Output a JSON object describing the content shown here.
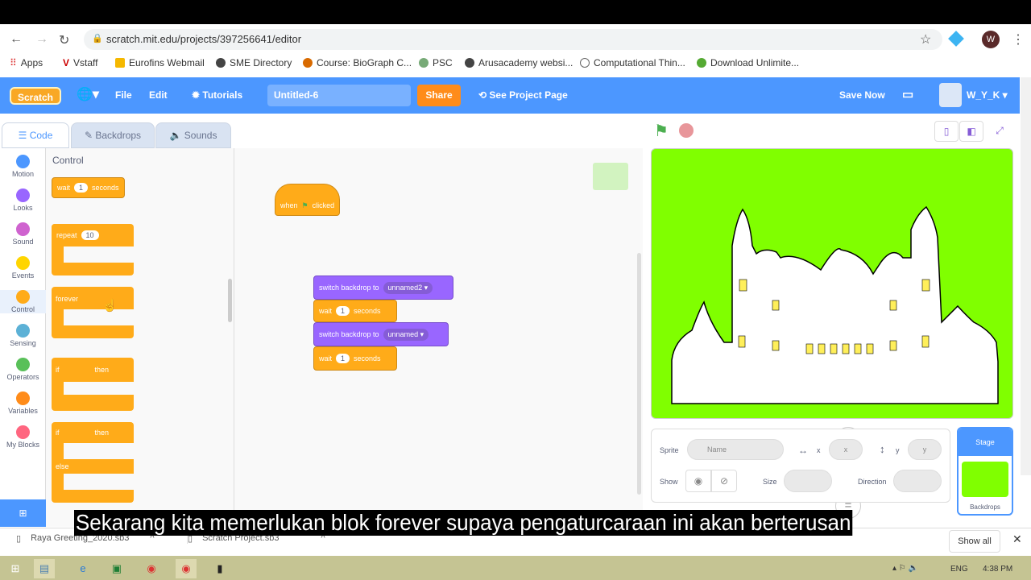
{
  "browser": {
    "url": "scratch.mit.edu/projects/397256641/editor",
    "profile_initial": "W",
    "bookmarks": [
      "Apps",
      "Vstaff",
      "Eurofins Webmail",
      "SME Directory",
      "Course: BioGraph C...",
      "PSC",
      "Arusacademy websi...",
      "Computational Thin...",
      "Download Unlimite..."
    ]
  },
  "menubar": {
    "logo": "Scratch",
    "file": "File",
    "edit": "Edit",
    "tutorials": "Tutorials",
    "project_title": "Untitled-6",
    "share": "Share",
    "see_project": "See Project Page",
    "save_now": "Save Now",
    "username": "W_Y_K"
  },
  "tabs": [
    "Code",
    "Backdrops",
    "Sounds"
  ],
  "categories": [
    {
      "label": "Motion",
      "color": "#4c97ff"
    },
    {
      "label": "Looks",
      "color": "#9966ff"
    },
    {
      "label": "Sound",
      "color": "#cf63cf"
    },
    {
      "label": "Events",
      "color": "#ffd500"
    },
    {
      "label": "Control",
      "color": "#ffab19"
    },
    {
      "label": "Sensing",
      "color": "#5cb1d6"
    },
    {
      "label": "Operators",
      "color": "#59c059"
    },
    {
      "label": "Variables",
      "color": "#ff8c1a"
    },
    {
      "label": "My Blocks",
      "color": "#ff6680"
    }
  ],
  "palette": {
    "heading": "Control",
    "wait": "wait",
    "wait_val": "1",
    "seconds": "seconds",
    "repeat": "repeat",
    "repeat_val": "10",
    "forever": "forever",
    "if": "if",
    "then": "then",
    "else": "else"
  },
  "script": {
    "hat_when": "when",
    "hat_clicked": "clicked",
    "switch_backdrop": "switch backdrop to",
    "backdrop1": "unnamed2",
    "backdrop2": "unnamed",
    "wait": "wait",
    "wait_val": "1",
    "seconds": "seconds"
  },
  "sprite_info": {
    "sprite": "Sprite",
    "name_placeholder": "Name",
    "x": "x",
    "y": "y",
    "show": "Show",
    "size": "Size",
    "direction": "Direction"
  },
  "stage_selector": {
    "title": "Stage",
    "backdrops": "Backdrops"
  },
  "subtitle": "Sekarang kita memerlukan blok forever supaya pengaturcaraan ini akan berterusan",
  "downloads": {
    "files": [
      "Raya Greeting_2020.sb3",
      "Scratch Project.sb3"
    ],
    "show_all": "Show all"
  },
  "taskbar": {
    "lang": "ENG",
    "time": "4:38 PM"
  },
  "colors": {
    "scratch_blue": "#4c97ff",
    "control": "#ffab19",
    "looks": "#9966ff",
    "stage_bg": "#80ff00"
  }
}
